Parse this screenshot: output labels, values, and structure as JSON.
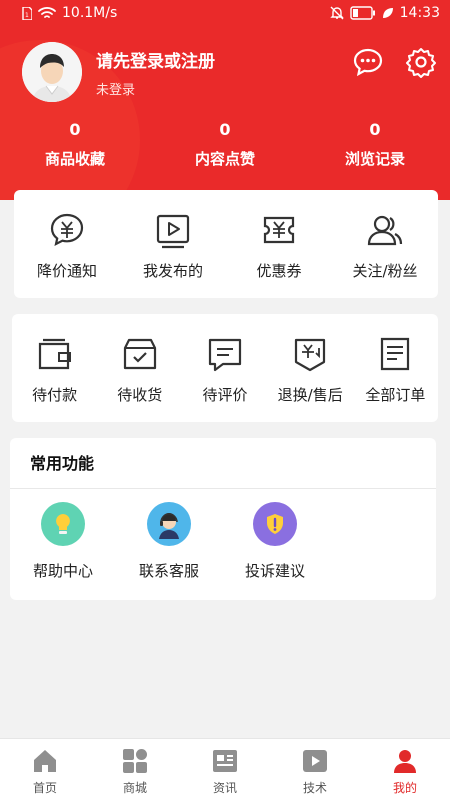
{
  "status_bar": {
    "speed": "10.1M/s",
    "battery": "27",
    "time": "14:33"
  },
  "user": {
    "login_prompt": "请先登录或注册",
    "status": "未登录"
  },
  "stats": [
    {
      "count": "0",
      "label": "商品收藏"
    },
    {
      "count": "0",
      "label": "内容点赞"
    },
    {
      "count": "0",
      "label": "浏览记录"
    }
  ],
  "quick_actions": [
    {
      "label": "降价通知",
      "icon": "price-drop-icon"
    },
    {
      "label": "我发布的",
      "icon": "my-posts-icon"
    },
    {
      "label": "优惠券",
      "icon": "coupon-icon"
    },
    {
      "label": "关注/粉丝",
      "icon": "followers-icon"
    }
  ],
  "orders": [
    {
      "label": "待付款",
      "icon": "wallet-icon"
    },
    {
      "label": "待收货",
      "icon": "box-icon"
    },
    {
      "label": "待评价",
      "icon": "comment-icon"
    },
    {
      "label": "退换/售后",
      "icon": "refund-icon"
    },
    {
      "label": "全部订单",
      "icon": "order-list-icon"
    }
  ],
  "common_functions": {
    "title": "常用功能",
    "items": [
      {
        "label": "帮助中心",
        "icon": "help-bulb-icon",
        "color": "#5fd3b3"
      },
      {
        "label": "联系客服",
        "icon": "customer-service-icon",
        "color": "#4fb6ea"
      },
      {
        "label": "投诉建议",
        "icon": "complaint-shield-icon",
        "color": "#8a6fe0"
      }
    ]
  },
  "tabs": [
    {
      "label": "首页",
      "icon": "home-icon"
    },
    {
      "label": "商城",
      "icon": "shop-grid-icon"
    },
    {
      "label": "资讯",
      "icon": "news-icon"
    },
    {
      "label": "技术",
      "icon": "video-icon"
    },
    {
      "label": "我的",
      "icon": "profile-icon",
      "active": true
    }
  ],
  "colors": {
    "brand_red": "#ea2a2a",
    "active_tab": "#e12a2a"
  }
}
